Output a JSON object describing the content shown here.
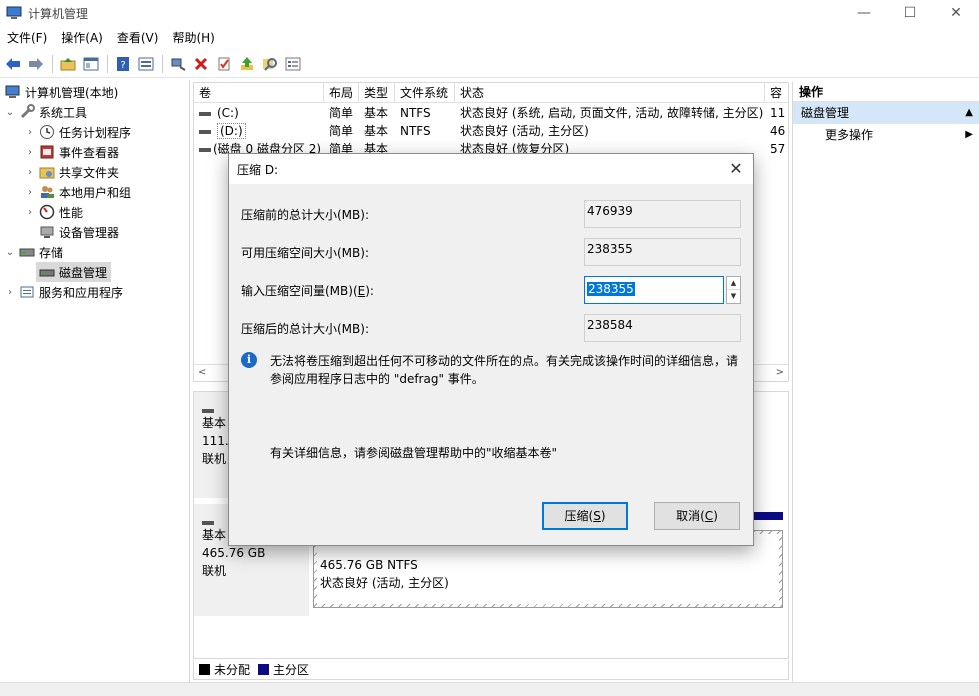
{
  "window": {
    "title": "计算机管理",
    "minimize": "—",
    "maximize": "☐",
    "close": "✕"
  },
  "menu": [
    "文件(F)",
    "操作(A)",
    "查看(V)",
    "帮助(H)"
  ],
  "tree": {
    "root": "计算机管理(本地)",
    "system_tools": "系统工具",
    "task_scheduler": "任务计划程序",
    "event_viewer": "事件查看器",
    "shared_folders": "共享文件夹",
    "local_users": "本地用户和组",
    "performance": "性能",
    "device_manager": "设备管理器",
    "storage": "存储",
    "disk_management": "磁盘管理",
    "services_apps": "服务和应用程序"
  },
  "volumes": {
    "headers": [
      "卷",
      "布局",
      "类型",
      "文件系统",
      "状态",
      "容"
    ],
    "rows": [
      {
        "name": "(C:)",
        "layout": "简单",
        "type": "基本",
        "fs": "NTFS",
        "status": "状态良好 (系统, 启动, 页面文件, 活动, 故障转储, 主分区)",
        "cap": "11"
      },
      {
        "name": "(D:)",
        "layout": "简单",
        "type": "基本",
        "fs": "NTFS",
        "status": "状态良好 (活动, 主分区)",
        "cap": "46"
      },
      {
        "name": "(磁盘 0 磁盘分区 2)",
        "layout": "简单",
        "type": "基本",
        "fs": "",
        "status": "状态良好 (恢复分区)",
        "cap": "57"
      }
    ]
  },
  "disks": {
    "disk0": {
      "type": "基本",
      "size": "111.",
      "status": "联机"
    },
    "disk1": {
      "type": "基本",
      "size": "465.76 GB",
      "status": "联机",
      "part_size": "465.76 GB NTFS",
      "part_status": "状态良好 (活动, 主分区)"
    }
  },
  "legend": {
    "unallocated": "未分配",
    "primary": "主分区"
  },
  "actions": {
    "header": "操作",
    "section": "磁盘管理",
    "more": "更多操作"
  },
  "dialog": {
    "title": "压缩 D:",
    "total_before_label": "压缩前的总计大小(MB):",
    "total_before_value": "476939",
    "available_label": "可用压缩空间大小(MB):",
    "available_value": "238355",
    "input_label_pre": "输入压缩空间量(MB)(",
    "input_label_key": "E",
    "input_label_post": "):",
    "input_value": "238355",
    "total_after_label": "压缩后的总计大小(MB):",
    "total_after_value": "238584",
    "info": "无法将卷压缩到超出任何不可移动的文件所在的点。有关完成该操作时间的详细信息，请参阅应用程序日志中的 \"defrag\" 事件。",
    "more_info": "有关详细信息，请参阅磁盘管理帮助中的\"收缩基本卷\"",
    "shrink_pre": "压缩(",
    "shrink_key": "S",
    "shrink_post": ")",
    "cancel_pre": "取消(",
    "cancel_key": "C",
    "cancel_post": ")"
  },
  "colors": {
    "primary_partition": "#0b0b84",
    "accent": "#0078d7",
    "selected_action": "#d4e6f7"
  }
}
